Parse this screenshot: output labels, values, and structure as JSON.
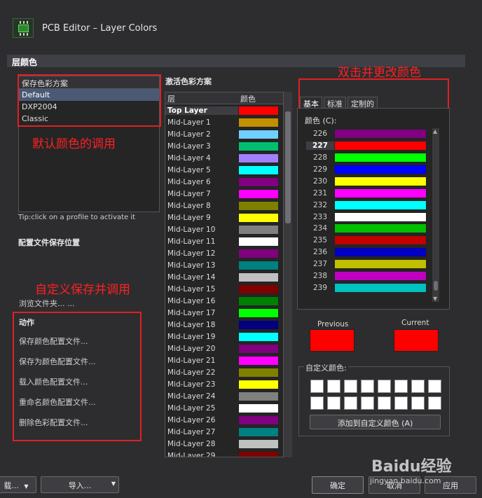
{
  "window": {
    "title": "PCB Editor – Layer Colors"
  },
  "section_title": "层颜色",
  "schemes": {
    "header": "保存色彩方案",
    "items": [
      "Default",
      "DXP2004",
      "Classic"
    ],
    "selected": "Default"
  },
  "tip": "Tip:click on a profile to activate it",
  "config_save_location": "配置文件保存位置",
  "browse_folder": "浏览文件夹... ...",
  "actions": {
    "title": "动作",
    "items": [
      "保存颜色配置文件...",
      "保存为颜色配置文件...",
      "载入颜色配置文件...",
      "重命名颜色配置文件...",
      "删除色彩配置文件..."
    ]
  },
  "active_scheme": {
    "title": "激活色彩方案",
    "col_layer": "层",
    "col_color": "颜色",
    "rows": [
      {
        "name": "Top Layer",
        "color": "#ff0000"
      },
      {
        "name": "Mid-Layer 1",
        "color": "#c09000"
      },
      {
        "name": "Mid-Layer 2",
        "color": "#70d0ff"
      },
      {
        "name": "Mid-Layer 3",
        "color": "#00c070"
      },
      {
        "name": "Mid-Layer 4",
        "color": "#a080ff"
      },
      {
        "name": "Mid-Layer 5",
        "color": "#00ffff"
      },
      {
        "name": "Mid-Layer 6",
        "color": "#800080"
      },
      {
        "name": "Mid-Layer 7",
        "color": "#ff00ff"
      },
      {
        "name": "Mid-Layer 8",
        "color": "#808000"
      },
      {
        "name": "Mid-Layer 9",
        "color": "#ffff00"
      },
      {
        "name": "Mid-Layer 10",
        "color": "#808080"
      },
      {
        "name": "Mid-Layer 11",
        "color": "#ffffff"
      },
      {
        "name": "Mid-Layer 12",
        "color": "#800080"
      },
      {
        "name": "Mid-Layer 13",
        "color": "#008080"
      },
      {
        "name": "Mid-Layer 14",
        "color": "#c0c0c0"
      },
      {
        "name": "Mid-Layer 15",
        "color": "#800000"
      },
      {
        "name": "Mid-Layer 16",
        "color": "#008000"
      },
      {
        "name": "Mid-Layer 17",
        "color": "#00ff00"
      },
      {
        "name": "Mid-Layer 18",
        "color": "#000080"
      },
      {
        "name": "Mid-Layer 19",
        "color": "#00ffff"
      },
      {
        "name": "Mid-Layer 20",
        "color": "#800080"
      },
      {
        "name": "Mid-Layer 21",
        "color": "#ff00ff"
      },
      {
        "name": "Mid-Layer 22",
        "color": "#808000"
      },
      {
        "name": "Mid-Layer 23",
        "color": "#ffff00"
      },
      {
        "name": "Mid-Layer 24",
        "color": "#808080"
      },
      {
        "name": "Mid-Layer 25",
        "color": "#ffffff"
      },
      {
        "name": "Mid-Layer 26",
        "color": "#800080"
      },
      {
        "name": "Mid-Layer 27",
        "color": "#008080"
      },
      {
        "name": "Mid-Layer 28",
        "color": "#c0c0c0"
      },
      {
        "name": "Mid-Layer 29",
        "color": "#800000"
      }
    ]
  },
  "palette": {
    "tabs": [
      "基本",
      "标准",
      "定制的"
    ],
    "active_tab": "基本",
    "label": "颜色 (C):",
    "selected": "227",
    "rows": [
      {
        "index": "226",
        "color": "#800080"
      },
      {
        "index": "227",
        "color": "#ff0000"
      },
      {
        "index": "228",
        "color": "#00ff00"
      },
      {
        "index": "229",
        "color": "#0000ff"
      },
      {
        "index": "230",
        "color": "#ffff00"
      },
      {
        "index": "231",
        "color": "#ff00ff"
      },
      {
        "index": "232",
        "color": "#00ffff"
      },
      {
        "index": "233",
        "color": "#ffffff"
      },
      {
        "index": "234",
        "color": "#00c000"
      },
      {
        "index": "235",
        "color": "#c00000"
      },
      {
        "index": "236",
        "color": "#0000c0"
      },
      {
        "index": "237",
        "color": "#c0c000"
      },
      {
        "index": "238",
        "color": "#c000c0"
      },
      {
        "index": "239",
        "color": "#00c0c0"
      }
    ]
  },
  "previous_label": "Previous",
  "current_label": "Current",
  "previous_color": "#ff0000",
  "current_color": "#ff0000",
  "custom_colors": {
    "title": "自定义颜色:",
    "add_button": "添加到自定义颜色 (A)"
  },
  "annotations": {
    "default_call": "默认颜色的调用",
    "custom_save": "自定义保存并调用",
    "double_click": "双击并更改颜色"
  },
  "bottom": {
    "load_button": "载...",
    "import_button": "导入...",
    "ok_button": "确定",
    "cancel_button": "取消",
    "apply_button": "应用"
  },
  "watermark": {
    "logo": "Baidu经验",
    "url": "jingyan.baidu.com"
  }
}
